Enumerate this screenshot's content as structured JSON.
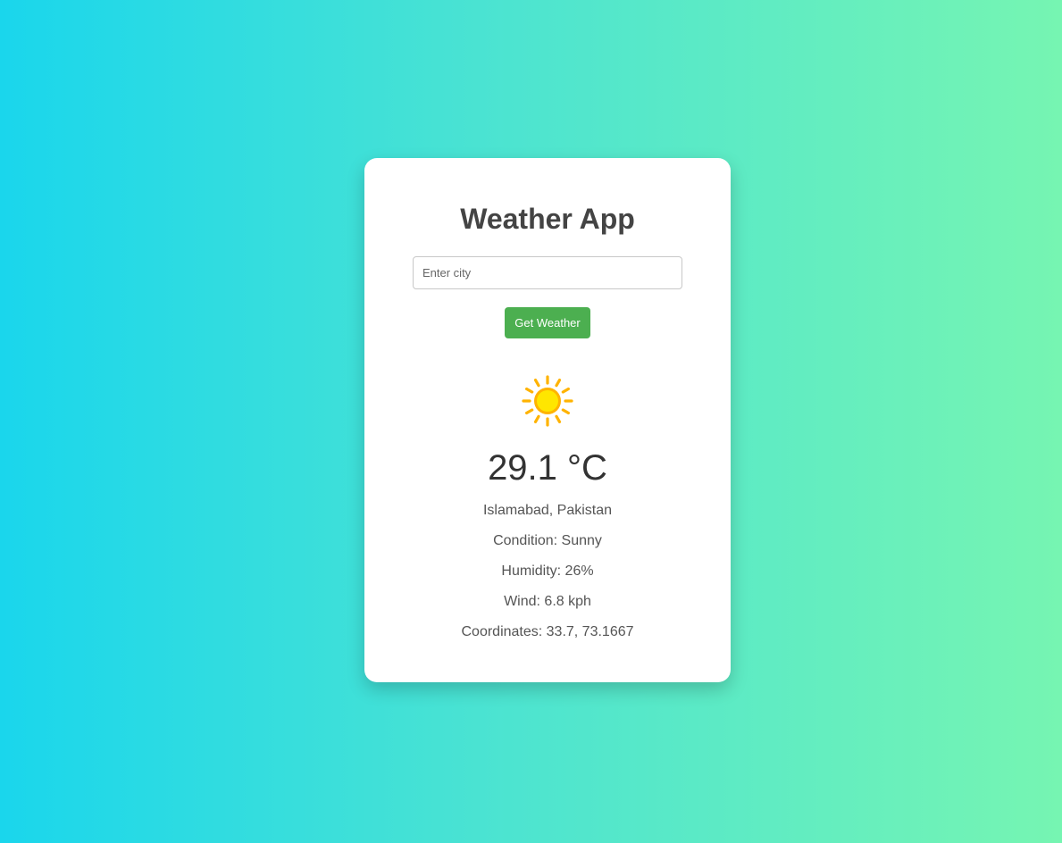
{
  "app": {
    "title": "Weather App"
  },
  "search": {
    "placeholder": "Enter city",
    "value": "",
    "button_label": "Get Weather"
  },
  "weather": {
    "icon": "sun-icon",
    "temperature": "29.1 °C",
    "location": "Islamabad, Pakistan",
    "condition": "Condition: Sunny",
    "humidity": "Humidity: 26%",
    "wind": "Wind: 6.8 kph",
    "coordinates": "Coordinates: 33.7, 73.1667"
  },
  "colors": {
    "button": "#4caf50",
    "background_start": "#1ad6ec",
    "background_end": "#76f5b2",
    "sun": "#ffd400"
  }
}
